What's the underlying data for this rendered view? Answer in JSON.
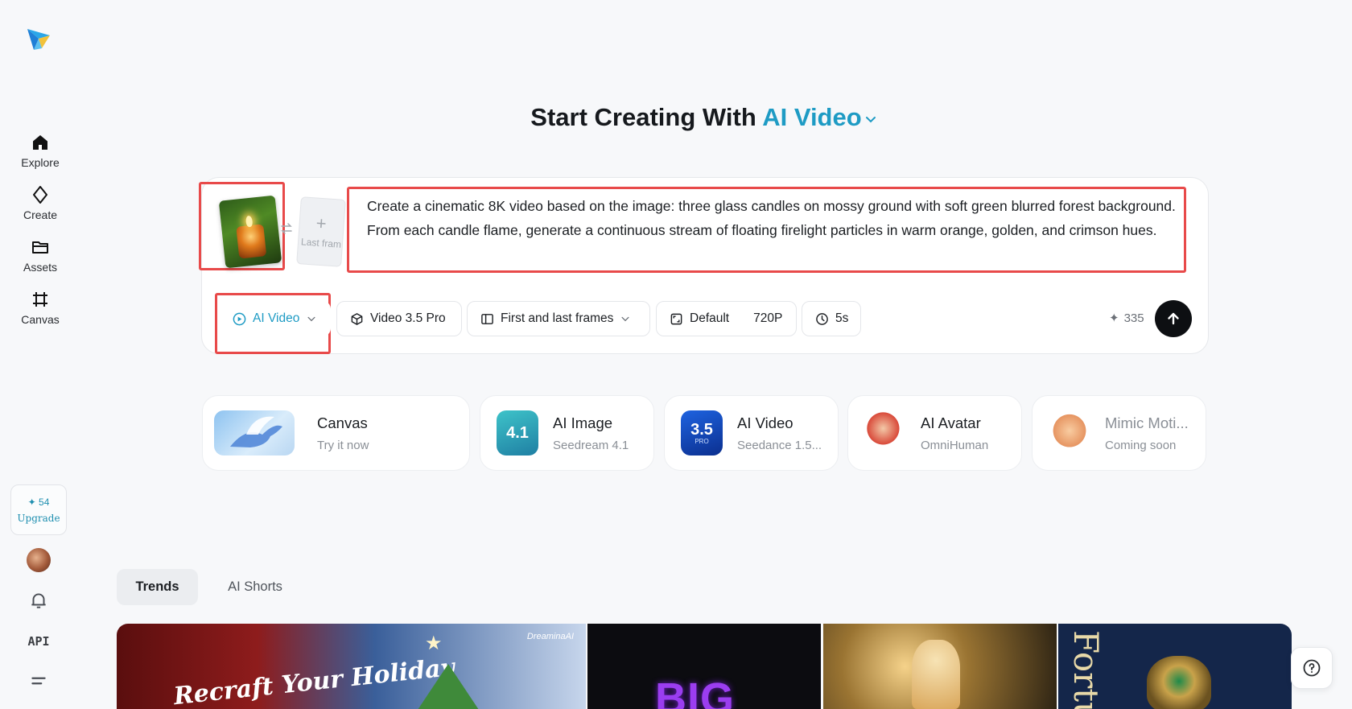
{
  "sidebar": {
    "logo_icon": "paper-plane-logo",
    "items": [
      {
        "label": "Explore",
        "icon": "home-icon"
      },
      {
        "label": "Create",
        "icon": "sparkle-diamond-icon"
      },
      {
        "label": "Assets",
        "icon": "folder-icon"
      },
      {
        "label": "Canvas",
        "icon": "crop-frame-icon"
      }
    ],
    "credits": "54",
    "upgrade_label": "Upgrade",
    "api_label": "API",
    "icons": [
      "bell-icon",
      "menu-icon",
      "avatar"
    ]
  },
  "heading": {
    "prefix": "Start Creating With ",
    "mode": "AI Video",
    "accent_color": "#1e9bc4"
  },
  "prompt": {
    "last_frame_label": "Last fram",
    "text": "Create a cinematic 8K video based on the image: three glass candles on mossy ground with soft green blurred forest background. From each candle flame, generate a continuous stream of floating firelight particles in warm orange, golden, and crimson hues."
  },
  "toolbar": {
    "mode_label": "AI Video",
    "model_label": "Video 3.5 Pro",
    "frames_label": "First and last frames",
    "ratio_label": "Default",
    "resolution_label": "720P",
    "duration_label": "5s",
    "cost": "335"
  },
  "features": [
    {
      "title": "Canvas",
      "subtitle": "Try it now"
    },
    {
      "title": "AI Image",
      "subtitle": "Seedream 4.1",
      "badge": "4.1"
    },
    {
      "title": "AI Video",
      "subtitle": "Seedance 1.5...",
      "badge": "3.5",
      "badge_sub": "PRO"
    },
    {
      "title": "AI Avatar",
      "subtitle": "OmniHuman"
    },
    {
      "title": "Mimic Moti...",
      "subtitle": "Coming soon"
    }
  ],
  "tabs": [
    {
      "label": "Trends",
      "active": true
    },
    {
      "label": "AI Shorts",
      "active": false
    }
  ],
  "gallery": {
    "tile1_text": "Recraft Your Holiday",
    "tile1_brand": "DreaminaAI",
    "tile2_text": "BIG",
    "tile4_text": "Fortu"
  },
  "highlight_color": "#e84a4a"
}
